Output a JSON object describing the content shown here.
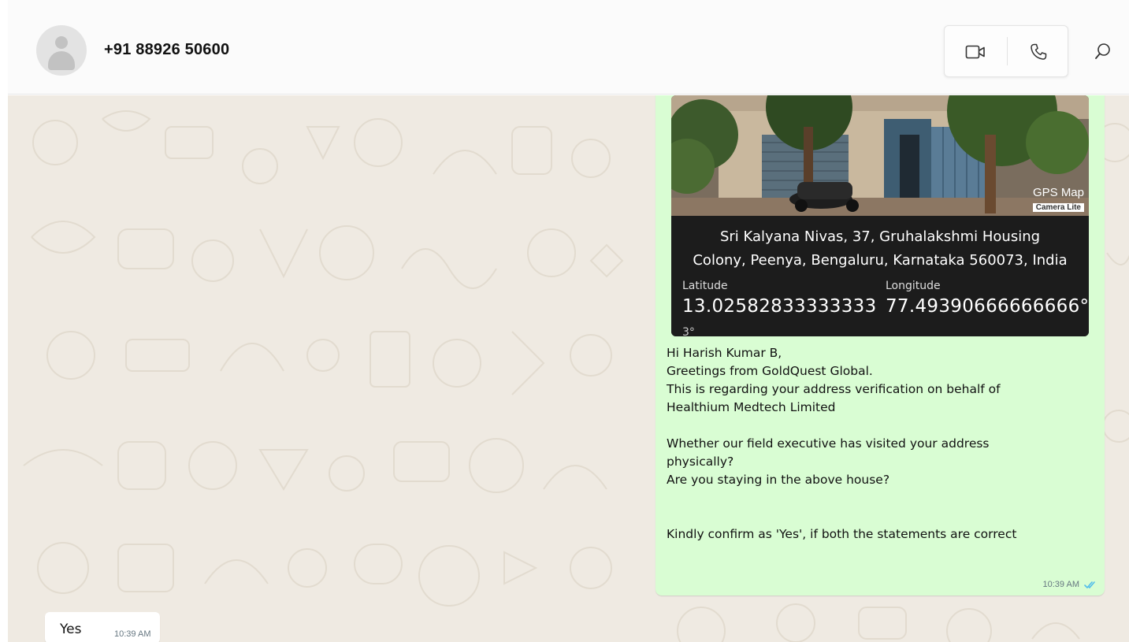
{
  "contact": {
    "phone": "+91 88926 50600",
    "avatar_icon": "default-avatar-icon"
  },
  "header_actions": {
    "video_icon": "video-call-icon",
    "voice_icon": "voice-call-icon",
    "search_icon": "search-icon"
  },
  "photo": {
    "badge_title": "GPS Map",
    "badge_sub": "Camera Lite",
    "address_line1": "Sri Kalyana Nivas, 37, Gruhalakshmi Housing",
    "address_line2": "Colony, Peenya, Bengaluru, Karnataka 560073, India",
    "latitude_label": "Latitude",
    "longitude_label": "Longitude",
    "latitude_value": "13.02582833333333",
    "longitude_value": "77.49390666666666°",
    "cut_text": "3°"
  },
  "outgoing_message": {
    "text": "Hi Harish Kumar B,\nGreetings from GoldQuest Global.\nThis is regarding your address verification on behalf of\nHealthium Medtech Limited\n\nWhether our field executive has visited your address\nphysically?\nAre you staying in the above house?\n\n\nKindly confirm as 'Yes', if both the statements are correct",
    "time": "10:39 AM",
    "status_icon": "double-check-icon",
    "status_color": "#53bdeb"
  },
  "incoming_message": {
    "text": "Yes",
    "time": "10:39 AM"
  },
  "colors": {
    "chat_background": "#efeae2",
    "outgoing_bubble": "#d9fdd3",
    "incoming_bubble": "#ffffff"
  }
}
